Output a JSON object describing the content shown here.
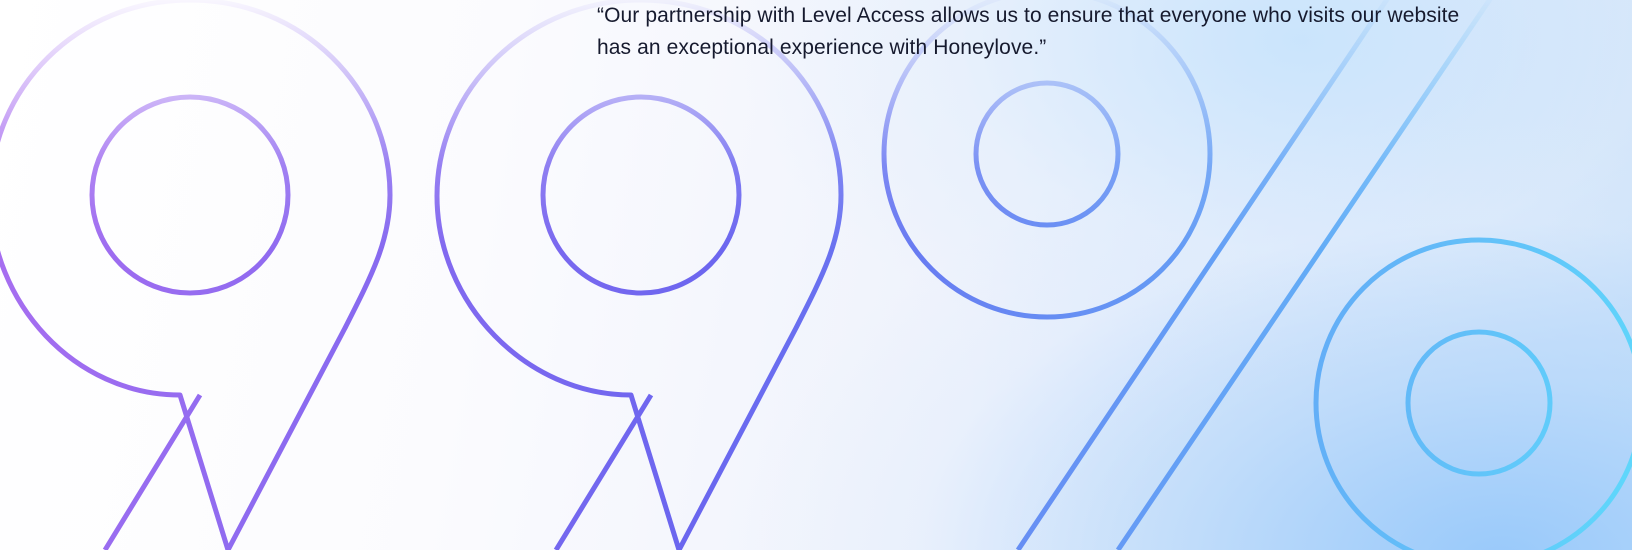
{
  "quote": {
    "text": "“Our partnership with Level Access allows us to ensure that everyone who visits our website has an exceptional experience with Honeylove.”"
  },
  "graphic": {
    "label": "99%",
    "gradient_start": "#a86ef0",
    "gradient_mid": "#6a66ef",
    "gradient_end": "#5fd6fb"
  }
}
